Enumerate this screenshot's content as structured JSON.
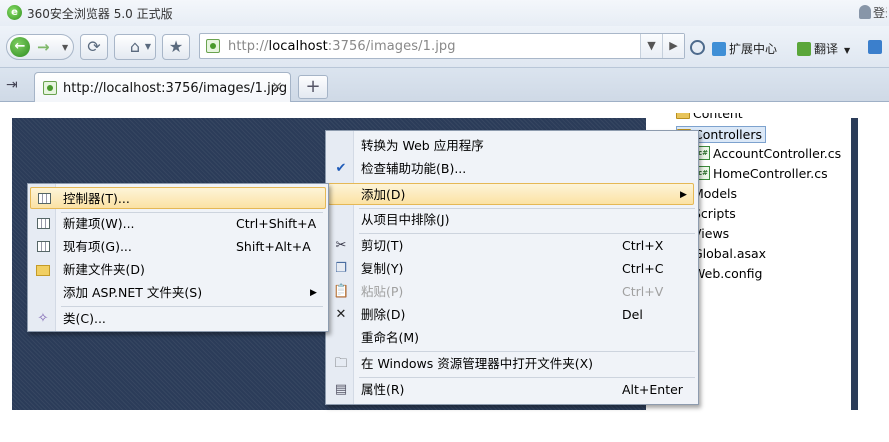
{
  "browser": {
    "window_title": "360安全浏览器 5.0 正式版",
    "user_label": "登录",
    "address": {
      "url_prefix": "http://",
      "url_host": "localhost",
      "url_rest": ":3756/images/1.jpg"
    },
    "toolbar": {
      "extensions_label": "扩展中心",
      "translate_label": "翻译"
    },
    "tab": {
      "title": "http://localhost:3756/images/1.jpg",
      "close_glyph": "×",
      "new_tab_glyph": "+"
    }
  },
  "solution_explorer": {
    "items": [
      {
        "label": "Content",
        "icon": "folder-icon"
      },
      {
        "label": "Controllers",
        "icon": "folder-icon",
        "selected": true
      },
      {
        "label": "AccountController.cs",
        "icon": "cs-file-icon"
      },
      {
        "label": "HomeController.cs",
        "icon": "cs-file-icon"
      },
      {
        "label": "Models",
        "icon": "folder-icon"
      },
      {
        "label": "Scripts",
        "icon": "folder-icon"
      },
      {
        "label": "Views",
        "icon": "folder-icon"
      },
      {
        "label": "Global.asax",
        "icon": "file-icon"
      },
      {
        "label": "Web.config",
        "icon": "file-icon"
      }
    ]
  },
  "context_menu": {
    "items": [
      {
        "label": "转换为 Web 应用程序",
        "shortcut": ""
      },
      {
        "label": "检查辅助功能(B)...",
        "shortcut": "",
        "icon": "accessibility-check-icon"
      },
      {
        "label": "添加(D)",
        "shortcut": "",
        "submenu": true,
        "highlighted": true
      },
      {
        "label": "从项目中排除(J)",
        "shortcut": ""
      },
      {
        "label": "剪切(T)",
        "shortcut": "Ctrl+X",
        "icon": "scissors-icon"
      },
      {
        "label": "复制(Y)",
        "shortcut": "Ctrl+C",
        "icon": "copy-icon"
      },
      {
        "label": "粘贴(P)",
        "shortcut": "Ctrl+V",
        "icon": "paste-icon",
        "disabled": true
      },
      {
        "label": "删除(D)",
        "shortcut": "Del",
        "icon": "delete-icon"
      },
      {
        "label": "重命名(M)",
        "shortcut": ""
      },
      {
        "label": "在 Windows 资源管理器中打开文件夹(X)",
        "shortcut": "",
        "icon": "open-folder-icon"
      },
      {
        "label": "属性(R)",
        "shortcut": "Alt+Enter",
        "icon": "properties-icon"
      }
    ]
  },
  "add_submenu": {
    "items": [
      {
        "label": "控制器(T)...",
        "shortcut": "",
        "icon": "controller-icon",
        "highlighted": true
      },
      {
        "label": "新建项(W)...",
        "shortcut": "Ctrl+Shift+A",
        "icon": "new-item-icon"
      },
      {
        "label": "现有项(G)...",
        "shortcut": "Shift+Alt+A",
        "icon": "existing-item-icon"
      },
      {
        "label": "新建文件夹(D)",
        "shortcut": "",
        "icon": "new-folder-icon"
      },
      {
        "label": "添加 ASP.NET 文件夹(S)",
        "shortcut": "",
        "submenu": true
      },
      {
        "label": "类(C)...",
        "shortcut": "",
        "icon": "class-icon"
      }
    ]
  }
}
